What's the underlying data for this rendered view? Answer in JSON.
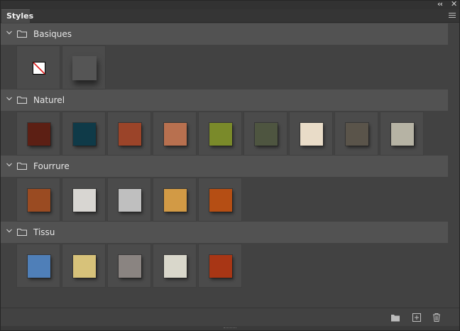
{
  "window": {
    "collapse_glyph": "‹‹",
    "close_glyph": "✕"
  },
  "tabs": [
    {
      "label": "Styles",
      "active": true
    }
  ],
  "groups": [
    {
      "name": "Basiques",
      "expanded": true,
      "styles": [
        {
          "name": "none-style",
          "color": "none"
        },
        {
          "name": "default-style",
          "color": "#555555"
        }
      ]
    },
    {
      "name": "Naturel",
      "expanded": true,
      "styles": [
        {
          "name": "red-stone",
          "color": "#5c1f14"
        },
        {
          "name": "teal-stone",
          "color": "#0f3a48"
        },
        {
          "name": "wood",
          "color": "#9b4429"
        },
        {
          "name": "wood-planks",
          "color": "#b8704f"
        },
        {
          "name": "grass",
          "color": "#7a8a2a"
        },
        {
          "name": "marble-dark",
          "color": "#4e5540"
        },
        {
          "name": "marble-white",
          "color": "#e9dcc8"
        },
        {
          "name": "granite",
          "color": "#5a544a"
        },
        {
          "name": "pyramid",
          "color": "#b6b3a4"
        }
      ]
    },
    {
      "name": "Fourrure",
      "expanded": true,
      "styles": [
        {
          "name": "fur-brown",
          "color": "#9a4b22"
        },
        {
          "name": "fur-white",
          "color": "#d8d6d2"
        },
        {
          "name": "zebra",
          "color": "#bfbfbf"
        },
        {
          "name": "leopard",
          "color": "#d29a45"
        },
        {
          "name": "tiger",
          "color": "#b54e14"
        }
      ]
    },
    {
      "name": "Tissu",
      "expanded": true,
      "styles": [
        {
          "name": "fabric-blue",
          "color": "#4f7fb8"
        },
        {
          "name": "fabric-yellow",
          "color": "#d7c27a"
        },
        {
          "name": "fabric-gray",
          "color": "#8a8481"
        },
        {
          "name": "fabric-cream",
          "color": "#d9d7cb"
        },
        {
          "name": "fabric-red",
          "color": "#a83615"
        }
      ]
    }
  ],
  "footer": {
    "icons": [
      "folder-icon",
      "new-style-icon",
      "trash-icon"
    ]
  }
}
